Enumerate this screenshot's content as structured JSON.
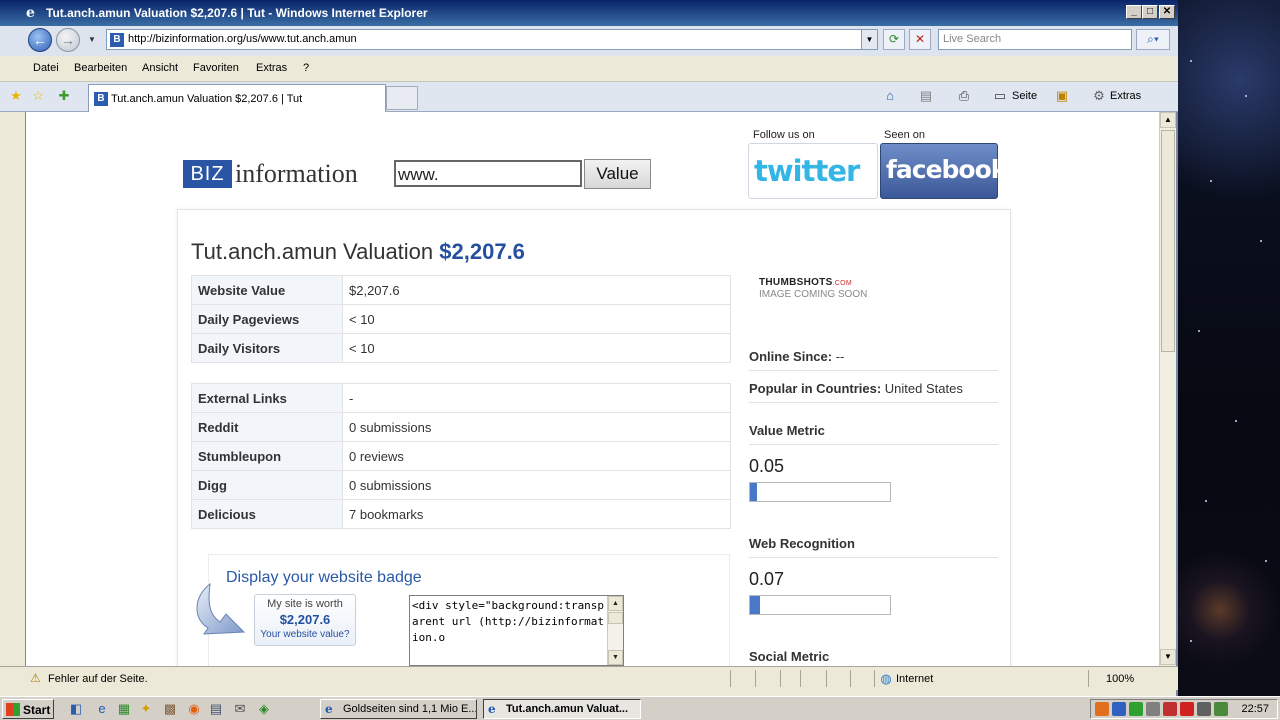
{
  "window": {
    "title": "Tut.anch.amun Valuation $2,207.6 | Tut - Windows Internet Explorer",
    "minimize": "_",
    "maximize": "□",
    "close": "✕"
  },
  "address_bar": {
    "url": "http://bizinformation.org/us/www.tut.anch.amun",
    "search_placeholder": "Live Search",
    "icons": [
      "back-arrow-icon",
      "forward-arrow-icon",
      "refresh-icon",
      "stop-icon",
      "search-icon"
    ]
  },
  "menu": [
    "Datei",
    "Bearbeiten",
    "Ansicht",
    "Favoriten",
    "Extras",
    "?"
  ],
  "tab": {
    "label": "Tut.anch.amun Valuation $2,207.6 | Tut"
  },
  "command_bar": {
    "page_label": "Seite",
    "tools_label": "Extras"
  },
  "site": {
    "logo_box": "BIZ",
    "logo_text": "information",
    "domain_input": "www.",
    "value_button": "Value",
    "follow_label": "Follow us on",
    "seen_label": "Seen on",
    "twitter": "twitter",
    "facebook": "facebook"
  },
  "report": {
    "title_prefix": "Tut.anch.amun Valuation",
    "title_value": "$2,207.6",
    "table1": [
      {
        "key": "Website Value",
        "value": "$2,207.6"
      },
      {
        "key": "Daily Pageviews",
        "value": "< 10"
      },
      {
        "key": "Daily Visitors",
        "value": "< 10"
      }
    ],
    "table2": [
      {
        "key": "External Links",
        "value": "-"
      },
      {
        "key": "Reddit",
        "value": "0 submissions"
      },
      {
        "key": "Stumbleupon",
        "value": "0 reviews"
      },
      {
        "key": "Digg",
        "value": "0 submissions"
      },
      {
        "key": "Delicious",
        "value": "7 bookmarks"
      }
    ],
    "thumb_brand": "THUMBSHOTS",
    "thumb_brand_suffix": ".COM",
    "thumb_text": "IMAGE COMING SOON",
    "online_since_label": "Online Since:",
    "online_since_value": "--",
    "popular_label": "Popular in Countries:",
    "popular_value": "United States",
    "value_metric_label": "Value Metric",
    "value_metric": "0.05",
    "value_metric_fill": 0.05,
    "web_recognition_label": "Web Recognition",
    "web_recognition": "0.07",
    "web_recognition_fill": 0.07,
    "social_metric_label": "Social Metric",
    "badge_title": "Display your website badge",
    "badge_line1": "My site is worth",
    "badge_value": "$2,207.6",
    "badge_line3": "Your website value?",
    "badge_code": "<div style=\"background:transparent url (http://bizinformation.o"
  },
  "status": {
    "message": "Fehler auf der Seite.",
    "zone": "Internet",
    "zoom": "100%"
  },
  "taskbar": {
    "start": "Start",
    "tasks": [
      {
        "label": "Goldseiten sind 1,1 Mio E...",
        "active": false
      },
      {
        "label": "Tut.anch.amun Valuat...",
        "active": true
      }
    ],
    "clock": "22:57"
  }
}
